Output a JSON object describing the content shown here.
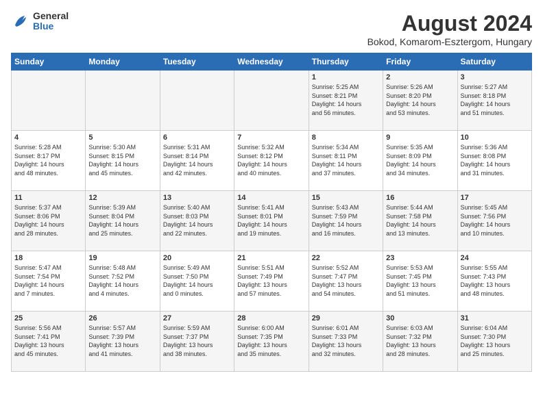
{
  "header": {
    "logo_general": "General",
    "logo_blue": "Blue",
    "title": "August 2024",
    "subtitle": "Bokod, Komarom-Esztergom, Hungary"
  },
  "days_of_week": [
    "Sunday",
    "Monday",
    "Tuesday",
    "Wednesday",
    "Thursday",
    "Friday",
    "Saturday"
  ],
  "weeks": [
    [
      {
        "day": "",
        "info": ""
      },
      {
        "day": "",
        "info": ""
      },
      {
        "day": "",
        "info": ""
      },
      {
        "day": "",
        "info": ""
      },
      {
        "day": "1",
        "info": "Sunrise: 5:25 AM\nSunset: 8:21 PM\nDaylight: 14 hours\nand 56 minutes."
      },
      {
        "day": "2",
        "info": "Sunrise: 5:26 AM\nSunset: 8:20 PM\nDaylight: 14 hours\nand 53 minutes."
      },
      {
        "day": "3",
        "info": "Sunrise: 5:27 AM\nSunset: 8:18 PM\nDaylight: 14 hours\nand 51 minutes."
      }
    ],
    [
      {
        "day": "4",
        "info": "Sunrise: 5:28 AM\nSunset: 8:17 PM\nDaylight: 14 hours\nand 48 minutes."
      },
      {
        "day": "5",
        "info": "Sunrise: 5:30 AM\nSunset: 8:15 PM\nDaylight: 14 hours\nand 45 minutes."
      },
      {
        "day": "6",
        "info": "Sunrise: 5:31 AM\nSunset: 8:14 PM\nDaylight: 14 hours\nand 42 minutes."
      },
      {
        "day": "7",
        "info": "Sunrise: 5:32 AM\nSunset: 8:12 PM\nDaylight: 14 hours\nand 40 minutes."
      },
      {
        "day": "8",
        "info": "Sunrise: 5:34 AM\nSunset: 8:11 PM\nDaylight: 14 hours\nand 37 minutes."
      },
      {
        "day": "9",
        "info": "Sunrise: 5:35 AM\nSunset: 8:09 PM\nDaylight: 14 hours\nand 34 minutes."
      },
      {
        "day": "10",
        "info": "Sunrise: 5:36 AM\nSunset: 8:08 PM\nDaylight: 14 hours\nand 31 minutes."
      }
    ],
    [
      {
        "day": "11",
        "info": "Sunrise: 5:37 AM\nSunset: 8:06 PM\nDaylight: 14 hours\nand 28 minutes."
      },
      {
        "day": "12",
        "info": "Sunrise: 5:39 AM\nSunset: 8:04 PM\nDaylight: 14 hours\nand 25 minutes."
      },
      {
        "day": "13",
        "info": "Sunrise: 5:40 AM\nSunset: 8:03 PM\nDaylight: 14 hours\nand 22 minutes."
      },
      {
        "day": "14",
        "info": "Sunrise: 5:41 AM\nSunset: 8:01 PM\nDaylight: 14 hours\nand 19 minutes."
      },
      {
        "day": "15",
        "info": "Sunrise: 5:43 AM\nSunset: 7:59 PM\nDaylight: 14 hours\nand 16 minutes."
      },
      {
        "day": "16",
        "info": "Sunrise: 5:44 AM\nSunset: 7:58 PM\nDaylight: 14 hours\nand 13 minutes."
      },
      {
        "day": "17",
        "info": "Sunrise: 5:45 AM\nSunset: 7:56 PM\nDaylight: 14 hours\nand 10 minutes."
      }
    ],
    [
      {
        "day": "18",
        "info": "Sunrise: 5:47 AM\nSunset: 7:54 PM\nDaylight: 14 hours\nand 7 minutes."
      },
      {
        "day": "19",
        "info": "Sunrise: 5:48 AM\nSunset: 7:52 PM\nDaylight: 14 hours\nand 4 minutes."
      },
      {
        "day": "20",
        "info": "Sunrise: 5:49 AM\nSunset: 7:50 PM\nDaylight: 14 hours\nand 0 minutes."
      },
      {
        "day": "21",
        "info": "Sunrise: 5:51 AM\nSunset: 7:49 PM\nDaylight: 13 hours\nand 57 minutes."
      },
      {
        "day": "22",
        "info": "Sunrise: 5:52 AM\nSunset: 7:47 PM\nDaylight: 13 hours\nand 54 minutes."
      },
      {
        "day": "23",
        "info": "Sunrise: 5:53 AM\nSunset: 7:45 PM\nDaylight: 13 hours\nand 51 minutes."
      },
      {
        "day": "24",
        "info": "Sunrise: 5:55 AM\nSunset: 7:43 PM\nDaylight: 13 hours\nand 48 minutes."
      }
    ],
    [
      {
        "day": "25",
        "info": "Sunrise: 5:56 AM\nSunset: 7:41 PM\nDaylight: 13 hours\nand 45 minutes."
      },
      {
        "day": "26",
        "info": "Sunrise: 5:57 AM\nSunset: 7:39 PM\nDaylight: 13 hours\nand 41 minutes."
      },
      {
        "day": "27",
        "info": "Sunrise: 5:59 AM\nSunset: 7:37 PM\nDaylight: 13 hours\nand 38 minutes."
      },
      {
        "day": "28",
        "info": "Sunrise: 6:00 AM\nSunset: 7:35 PM\nDaylight: 13 hours\nand 35 minutes."
      },
      {
        "day": "29",
        "info": "Sunrise: 6:01 AM\nSunset: 7:33 PM\nDaylight: 13 hours\nand 32 minutes."
      },
      {
        "day": "30",
        "info": "Sunrise: 6:03 AM\nSunset: 7:32 PM\nDaylight: 13 hours\nand 28 minutes."
      },
      {
        "day": "31",
        "info": "Sunrise: 6:04 AM\nSunset: 7:30 PM\nDaylight: 13 hours\nand 25 minutes."
      }
    ]
  ]
}
